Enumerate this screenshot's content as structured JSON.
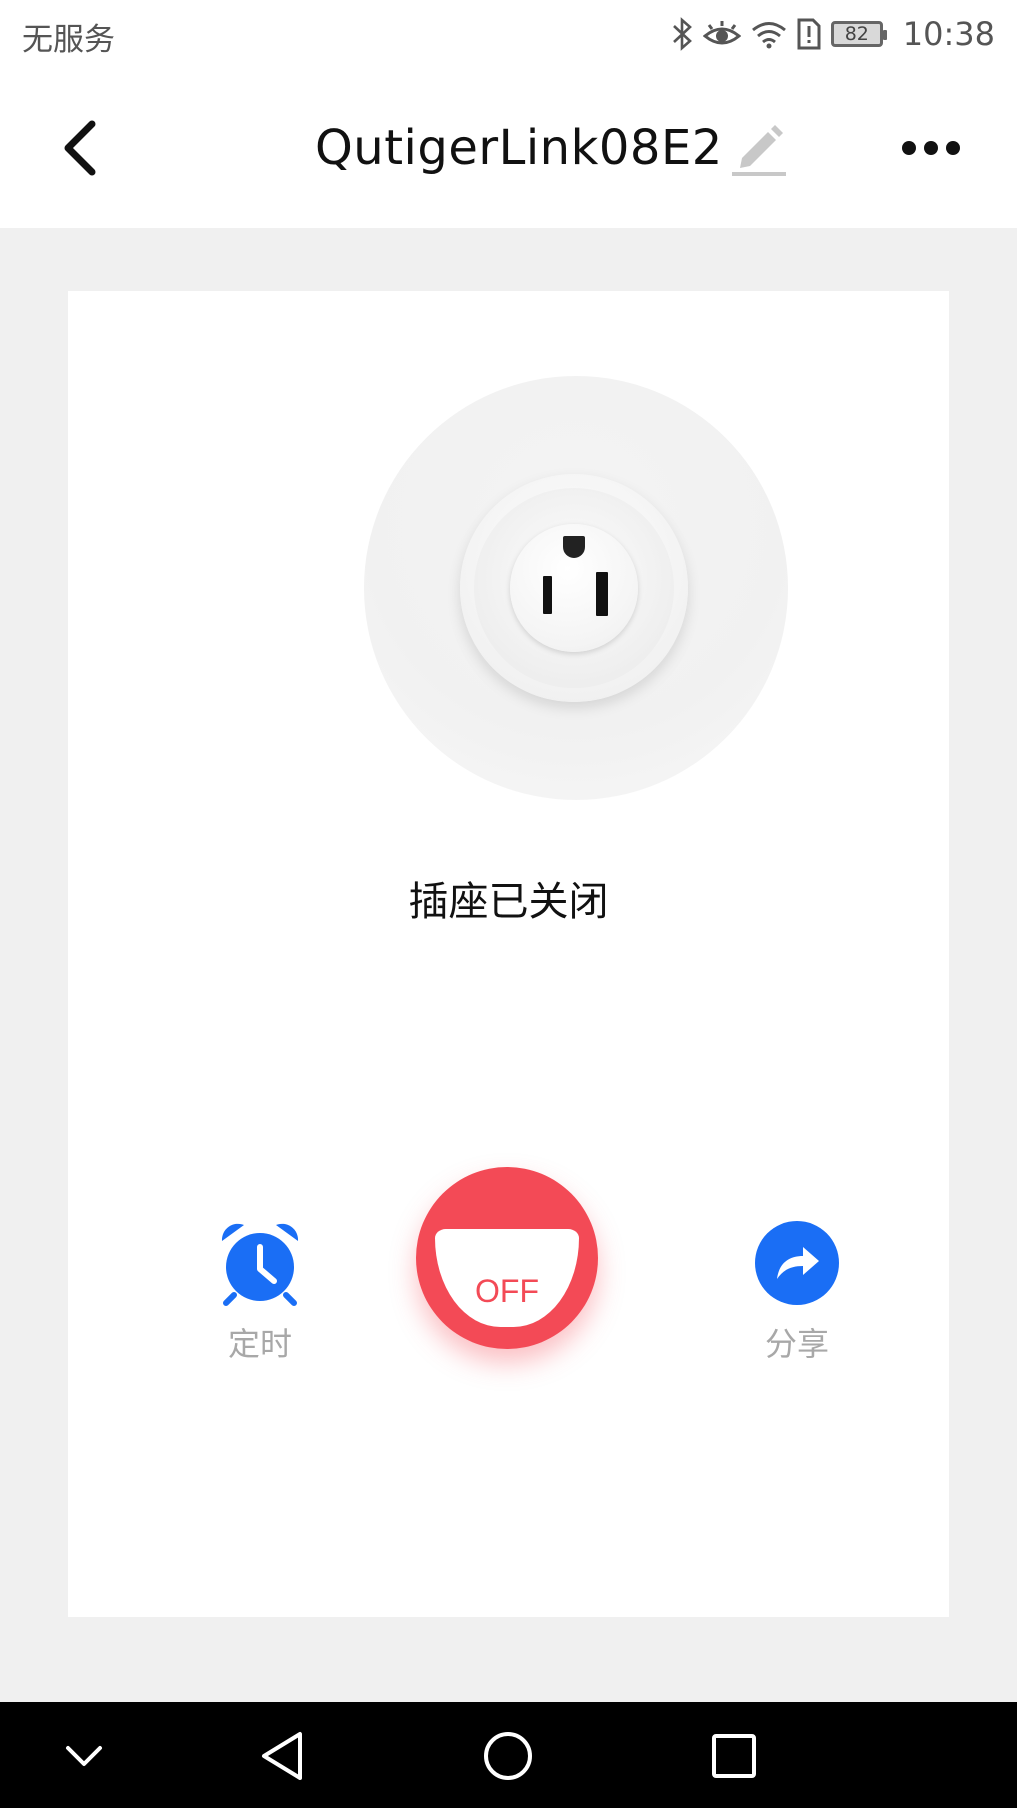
{
  "status_bar": {
    "carrier": "无服务",
    "battery": "82",
    "time": "10:38",
    "icons": [
      "bluetooth-icon",
      "eye-icon",
      "wifi-icon",
      "sim-alert-icon",
      "battery-icon"
    ]
  },
  "header": {
    "title": "QutigerLink08E2",
    "icons": [
      "back-arrow-icon",
      "edit-pencil-icon",
      "more-dots-icon"
    ]
  },
  "device": {
    "status_text": "插座已关闭",
    "power_label": "OFF",
    "power_color": "#f34a56"
  },
  "actions": {
    "timer_label": "定时",
    "share_label": "分享",
    "accent_color": "#1a6ef5"
  },
  "nav_bar": {
    "icons": [
      "chevron-down-icon",
      "back-triangle-icon",
      "home-circle-icon",
      "recents-square-icon"
    ]
  }
}
